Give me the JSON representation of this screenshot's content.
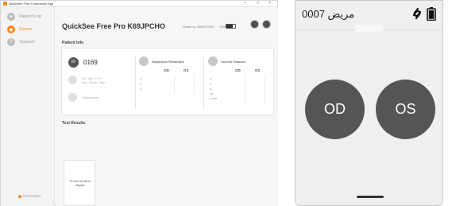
{
  "desktop": {
    "window_title": "QuickSee Free Companion App",
    "sidebar": {
      "items": [
        {
          "label": "Patient Log",
          "active": false,
          "icon": "person-icon"
        },
        {
          "label": "Device",
          "active": true,
          "icon": "device-icon"
        },
        {
          "label": "Support",
          "active": false,
          "icon": "help-icon"
        }
      ],
      "footer": "PlenOptika"
    },
    "header": {
      "title": "QuickSee Free Pro K69JPCHO",
      "serial": "Serial no: K69JPCHO",
      "battery_text": "74%",
      "battery_level": 0.74
    },
    "patient_info": {
      "section_title": "Patient Info",
      "id": "0169",
      "id_icon": "ID",
      "dob_format": "DD / MM / YYYY",
      "dob_parts": [
        "Day",
        "Month",
        "Year"
      ],
      "gender_label": "select gender",
      "subjective": {
        "title": "Subjective Refraction",
        "cols": [
          "OD",
          "OS"
        ],
        "rows": [
          "S",
          "C",
          "A"
        ]
      },
      "current": {
        "title": "Current Glasses",
        "cols": [
          "OD",
          "OS"
        ],
        "rows": [
          "S",
          "C",
          "A",
          "Ad",
          "p.size"
        ]
      }
    },
    "test_results": {
      "section_title": "Test Results",
      "empty_text": "No test results to display"
    }
  },
  "phone": {
    "title": "0007 مريض",
    "left_button": "OD",
    "right_button": "OS"
  },
  "colors": {
    "accent": "#f08a24",
    "dark_button": "#555555"
  }
}
